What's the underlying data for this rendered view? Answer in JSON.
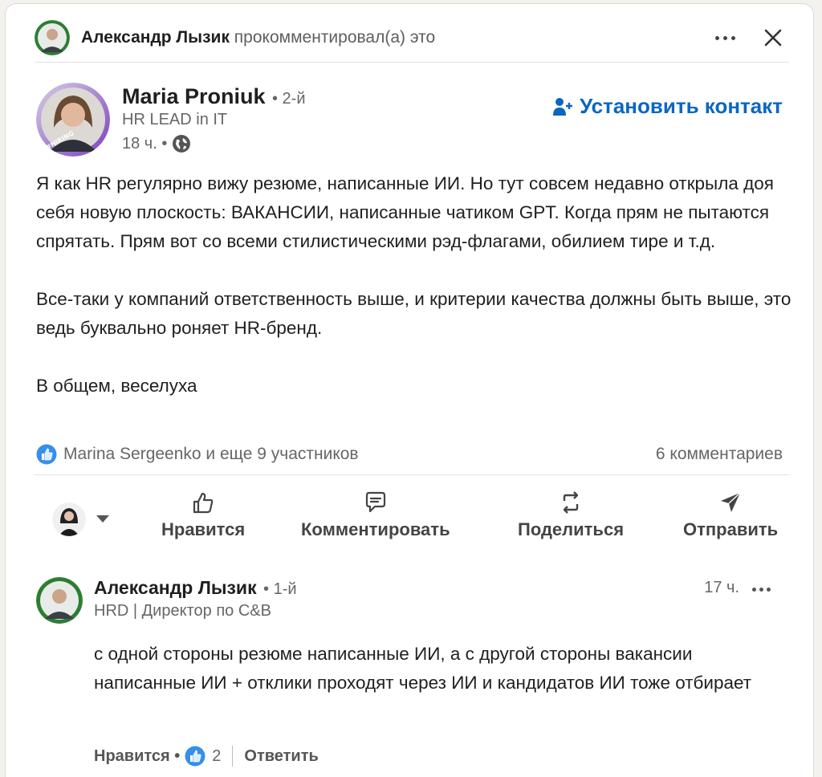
{
  "activity": {
    "actor": "Александр Лызик",
    "action_text": " прокомментировал(а) это",
    "more_icon": "more-horizontal-icon",
    "close_icon": "close-icon"
  },
  "post": {
    "author_name": "Maria Proniuk",
    "degree": "• 2-й",
    "headline": "HR LEAD in IT",
    "time": "18 ч. •",
    "connect_label": "Установить контакт",
    "body": [
      "Я как HR регулярно вижу резюме, написанные ИИ. Но тут совсем недавно открыла доя себя новую плоскость: ВАКАНСИИ, написанные чатиком GPT. Когда прям не пытаются спрятать. Прям вот со всеми стилистическими рэд-флагами, обилием тире и т.д.",
      "Все-таки у компаний ответственность выше, и критерии качества должны быть выше, это ведь буквально роняет HR-бренд.",
      "В общем, веселуха"
    ],
    "likes_text": "Marina Sergeenko и еще 9 участников",
    "comments_count": "6 комментариев"
  },
  "actions": {
    "like": "Нравится",
    "comment": "Комментировать",
    "share": "Поделиться",
    "send": "Отправить"
  },
  "comment": {
    "author_name": "Александр Лызик",
    "degree": "• 1-й",
    "headline": "HRD | Директор по C&B",
    "time": "17 ч.",
    "text": "с одной стороны резюме написанные ИИ, а с другой стороны вакансии написанные ИИ + отклики проходят через ИИ и кандидатов ИИ тоже отбирает",
    "like_label": "Нравится •",
    "like_count": "2",
    "reply_label": "Ответить"
  },
  "colors": {
    "accent": "#0a66c2",
    "text": "#1f1f1f",
    "muted": "#666666"
  }
}
